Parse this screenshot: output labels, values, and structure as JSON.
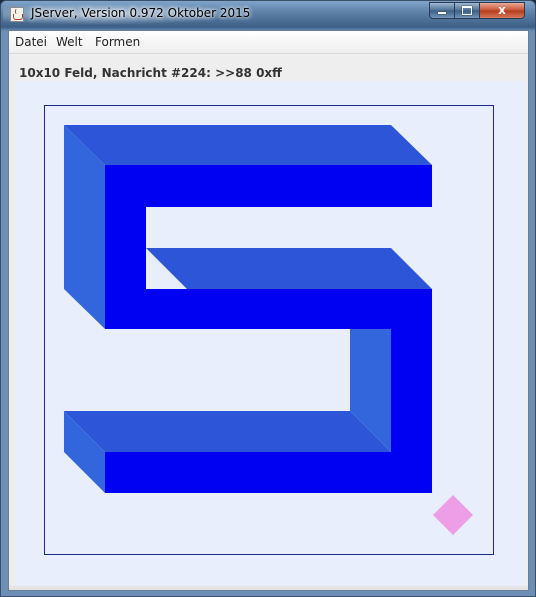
{
  "window": {
    "title": "JServer, Version 0.972 Oktober 2015",
    "icon": "java-cup-icon",
    "controls": {
      "minimize": "minimize-icon",
      "maximize": "maximize-icon",
      "close_label": "x"
    }
  },
  "menu": {
    "items": [
      {
        "label": "Datei"
      },
      {
        "label": "Welt"
      },
      {
        "label": "Formen"
      }
    ]
  },
  "status": {
    "message": "10x10 Feld, Nachricht #224: >>88 0xff"
  },
  "board": {
    "grid_size": 10,
    "colors": {
      "background": "#e8eefb",
      "frame": "#1a2a8a",
      "front": "#0000f2",
      "side": "#3366dd",
      "top": "#2c55d8",
      "marker": "#ee9ee6"
    },
    "shape": "S",
    "marker_shape": "diamond"
  }
}
